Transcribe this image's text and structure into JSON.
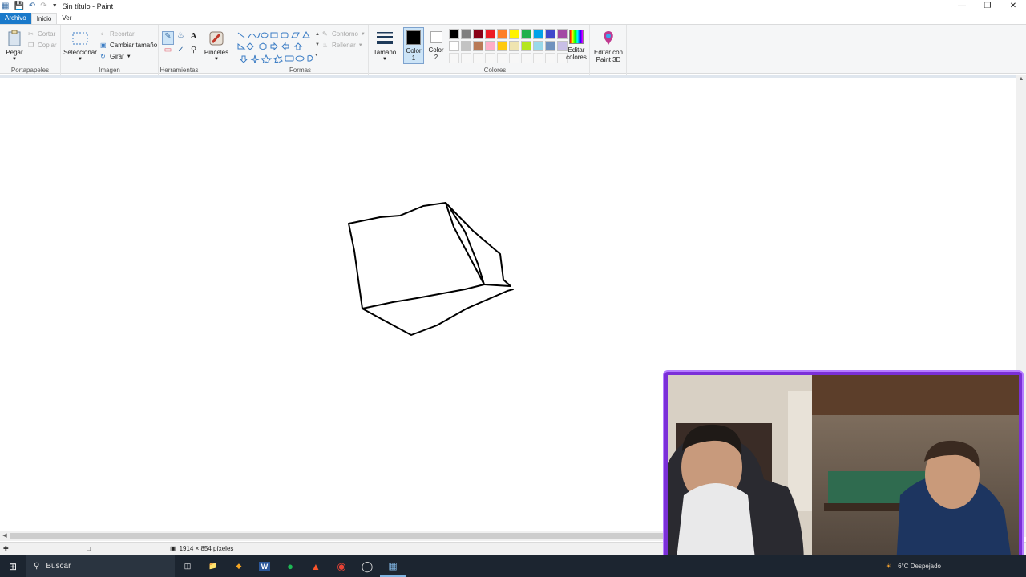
{
  "window": {
    "title": "Sin título - Paint"
  },
  "menu": {
    "tabs": [
      "Archivo",
      "Inicio",
      "Ver"
    ]
  },
  "ribbon": {
    "clipboard": {
      "group": "Portapapeles",
      "paste": "Pegar",
      "cut": "Cortar",
      "copy": "Copiar"
    },
    "image": {
      "group": "Imagen",
      "select": "Seleccionar",
      "crop": "Recortar",
      "resize": "Cambiar tamaño",
      "rotate": "Girar"
    },
    "tools": {
      "group": "Herramientas"
    },
    "brushes": {
      "label": "Pinceles"
    },
    "shapes": {
      "group": "Formas",
      "outline": "Contorno",
      "fill": "Rellenar"
    },
    "size": {
      "label": "Tamaño"
    },
    "colors": {
      "group": "Colores",
      "color1_line1": "Color",
      "color1_line2": "1",
      "color2_line1": "Color",
      "color2_line2": "2",
      "edit_line1": "Editar",
      "edit_line2": "colores",
      "paint3d_line1": "Editar con",
      "paint3d_line2": "Paint 3D",
      "color1": "#000000",
      "color2": "#ffffff",
      "palette": [
        "#000000",
        "#7f7f7f",
        "#880015",
        "#ed1c24",
        "#ff7f27",
        "#fff200",
        "#22b14c",
        "#00a2e8",
        "#3f48cc",
        "#a349a4",
        "#ffffff",
        "#c3c3c3",
        "#b97a57",
        "#ffaec9",
        "#ffc90e",
        "#efe4b0",
        "#b5e61d",
        "#99d9ea",
        "#7092be",
        "#c8bfe7",
        "#f7f7f7",
        "#f7f7f7",
        "#f7f7f7",
        "#f7f7f7",
        "#f7f7f7",
        "#f7f7f7",
        "#f7f7f7",
        "#f7f7f7",
        "#f7f7f7",
        "#f7f7f7"
      ]
    }
  },
  "status": {
    "dimensions": "1914 × 854 píxeles"
  },
  "taskbar": {
    "search_label": "Buscar",
    "weather": "6°C  Despejado"
  }
}
